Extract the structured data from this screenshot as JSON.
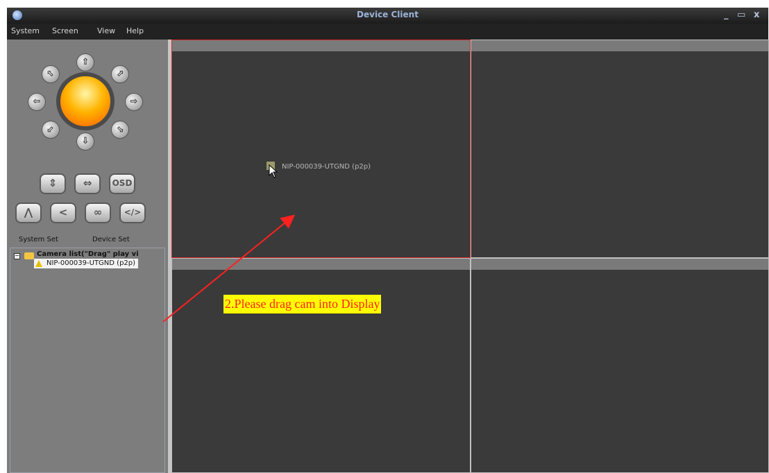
{
  "app": {
    "title": "Device Client",
    "minimize": "_",
    "maximize": "▭",
    "close": "x"
  },
  "menu": [
    "System",
    "Screen",
    "View",
    "Help"
  ],
  "ptz": {
    "up": "⇧",
    "down": "⇩",
    "left": "⇦",
    "right": "⇨",
    "up_left": "⬁",
    "up_right": "⬀",
    "down_left": "⬃",
    "down_right": "⬂"
  },
  "controls": {
    "vertical_flip": "⇕",
    "horizontal_flip": "⇔",
    "osd": "OSD",
    "row2": [
      "⋀",
      "<",
      "∞",
      "</>"
    ]
  },
  "settings": {
    "system_set": "System Set",
    "device_set": "Device Set"
  },
  "tree": {
    "expander": "−",
    "root": "Camera list(\"Drag\" play vi",
    "camera": "NIP-000039-UTGND (p2p)"
  },
  "display": {
    "dragged_camera": "NIP-000039-UTGND (p2p)",
    "instruction": "2.Please drag cam into Display"
  },
  "colors": {
    "selection": "#d52a2a",
    "instruction_text": "#ff2020",
    "instruction_bg": "#ffff00"
  }
}
